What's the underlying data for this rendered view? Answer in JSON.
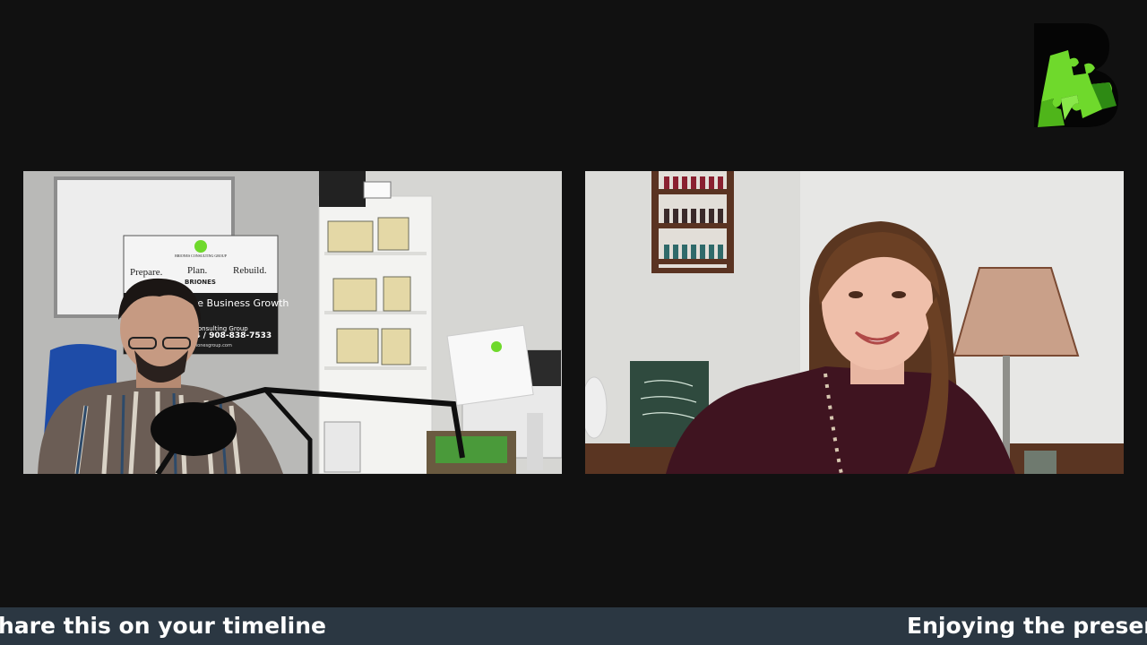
{
  "brand": {
    "logo_icon": "puzzle-b-logo-icon",
    "accent_green": "#6fd92c"
  },
  "participants": [
    {
      "role": "host-video"
    },
    {
      "role": "guest-video"
    }
  ],
  "sign": {
    "company_small": "BRIONES CONSULTING GROUP",
    "tagline_prepare": "Prepare.",
    "tagline_plan": "Plan.",
    "tagline_rebuild": "Rebuild.",
    "briones": "BRIONES",
    "headline": "re Business Growth",
    "subline": "Consulting Group",
    "phone": "14 / 908-838-7533",
    "website": "...ionesgroup.com"
  },
  "ticker": {
    "message_1": "hare this on your timeline",
    "message_2": "Enjoying the presentation"
  },
  "colors": {
    "ticker_bg": "#2b3742",
    "page_bg": "#111111"
  }
}
